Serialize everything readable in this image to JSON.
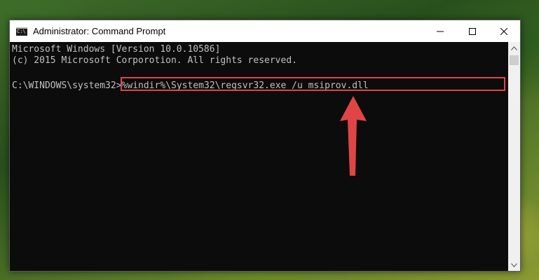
{
  "window": {
    "title": "Administrator: Command Prompt",
    "icon": "cmd-icon",
    "icon_glyph": "C:\\"
  },
  "controls": {
    "minimize_icon": "minimize-icon",
    "maximize_icon": "maximize-icon",
    "close_icon": "close-icon"
  },
  "console": {
    "lines": [
      "Microsoft Windows [Version 10.0.10586]",
      "(c) 2015 Microsoft Corporotion. All rights reserved."
    ],
    "prompt": "C:\\WINDOWS\\system32>",
    "command": "%windir%\\System32\\regsvr32.exe /u msiprov.dll"
  },
  "annotation": {
    "highlight_color": "#e04545",
    "arrow_color": "#e04545"
  }
}
